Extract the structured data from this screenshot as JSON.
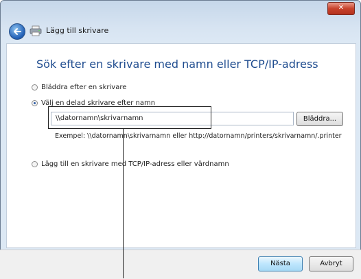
{
  "window": {
    "close_label": "✕"
  },
  "header": {
    "title": "Lägg till skrivare"
  },
  "main": {
    "heading": "Sök efter en skrivare med namn eller TCP/IP-adress",
    "options": [
      {
        "label": "Bläddra efter en skrivare",
        "checked": false
      },
      {
        "label": "Välj en delad skrivare efter namn",
        "checked": true
      },
      {
        "label": "Lägg till en skrivare med TCP/IP-adress eller värdnamn",
        "checked": false
      }
    ],
    "path_input": {
      "value": "\\\\datornamn\\skrivarnamn"
    },
    "browse_label": "Bläddra...",
    "example": "Exempel: \\\\datornamn\\skrivarnamn eller http://datornamn/printers/skrivarnamn/.printer"
  },
  "footer": {
    "next_label": "Nästa",
    "cancel_label": "Avbryt"
  },
  "colors": {
    "accent": "#1f4c8f",
    "title_bar": "#c6d7ea",
    "close": "#c8432d"
  },
  "icons": {
    "back": "back-arrow-icon",
    "printer": "printer-icon"
  }
}
